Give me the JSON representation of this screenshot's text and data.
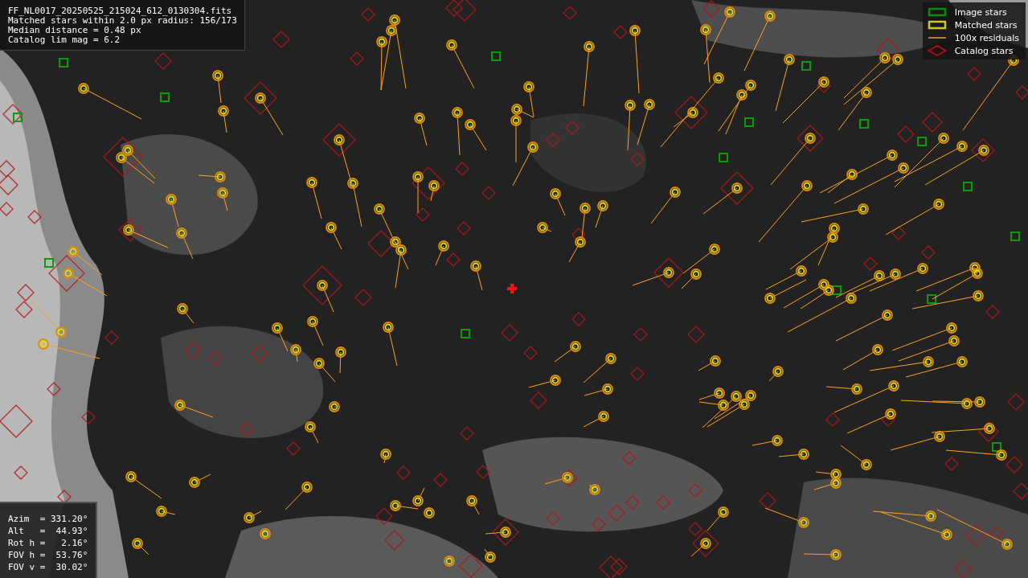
{
  "header": {
    "lines": [
      "FF_NL0017_20250525_215024_612_0130304.fits",
      "Matched stars within 2.0 px radius: 156/173",
      "Median distance = 0.48 px",
      "Catalog lim mag = 6.2"
    ]
  },
  "legend": [
    {
      "label": "Image stars"
    },
    {
      "kind": "matched",
      "label": "Matched stars"
    },
    {
      "kind": "residual",
      "label": "100x residuals"
    },
    {
      "kind": "catalog",
      "label": "Catalog stars"
    }
  ],
  "pointing": {
    "lines": [
      "Azim  = 331.20°",
      "Alt   =  44.93°",
      "Rot h =   2.16°",
      "FOV h =  53.76°",
      "FOV v =  30.02°"
    ]
  }
}
